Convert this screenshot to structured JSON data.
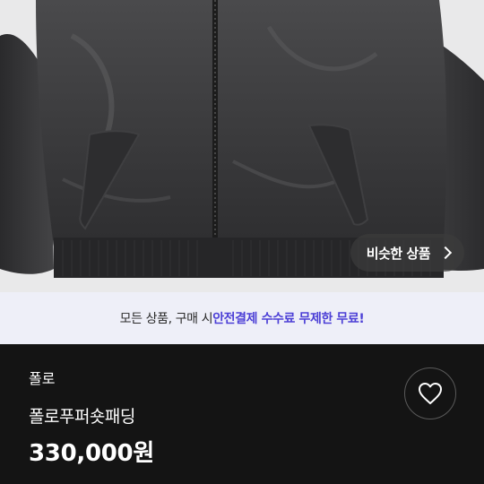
{
  "product_image": {
    "similar_button_label": "비슷한 상품"
  },
  "banner": {
    "prefix": "모든 상품, 구매 시 ",
    "highlight": "안전결제 수수료 무제한 무료!",
    "highlight_color": "#4b3fd6"
  },
  "product": {
    "brand": "폴로",
    "title": "폴로푸퍼숏패딩",
    "price": "330,000원"
  },
  "icons": {
    "like": "heart-outline-icon",
    "chevron": "chevron-right-icon"
  },
  "colors": {
    "background": "#141414",
    "banner_bg": "#eeeff8"
  }
}
